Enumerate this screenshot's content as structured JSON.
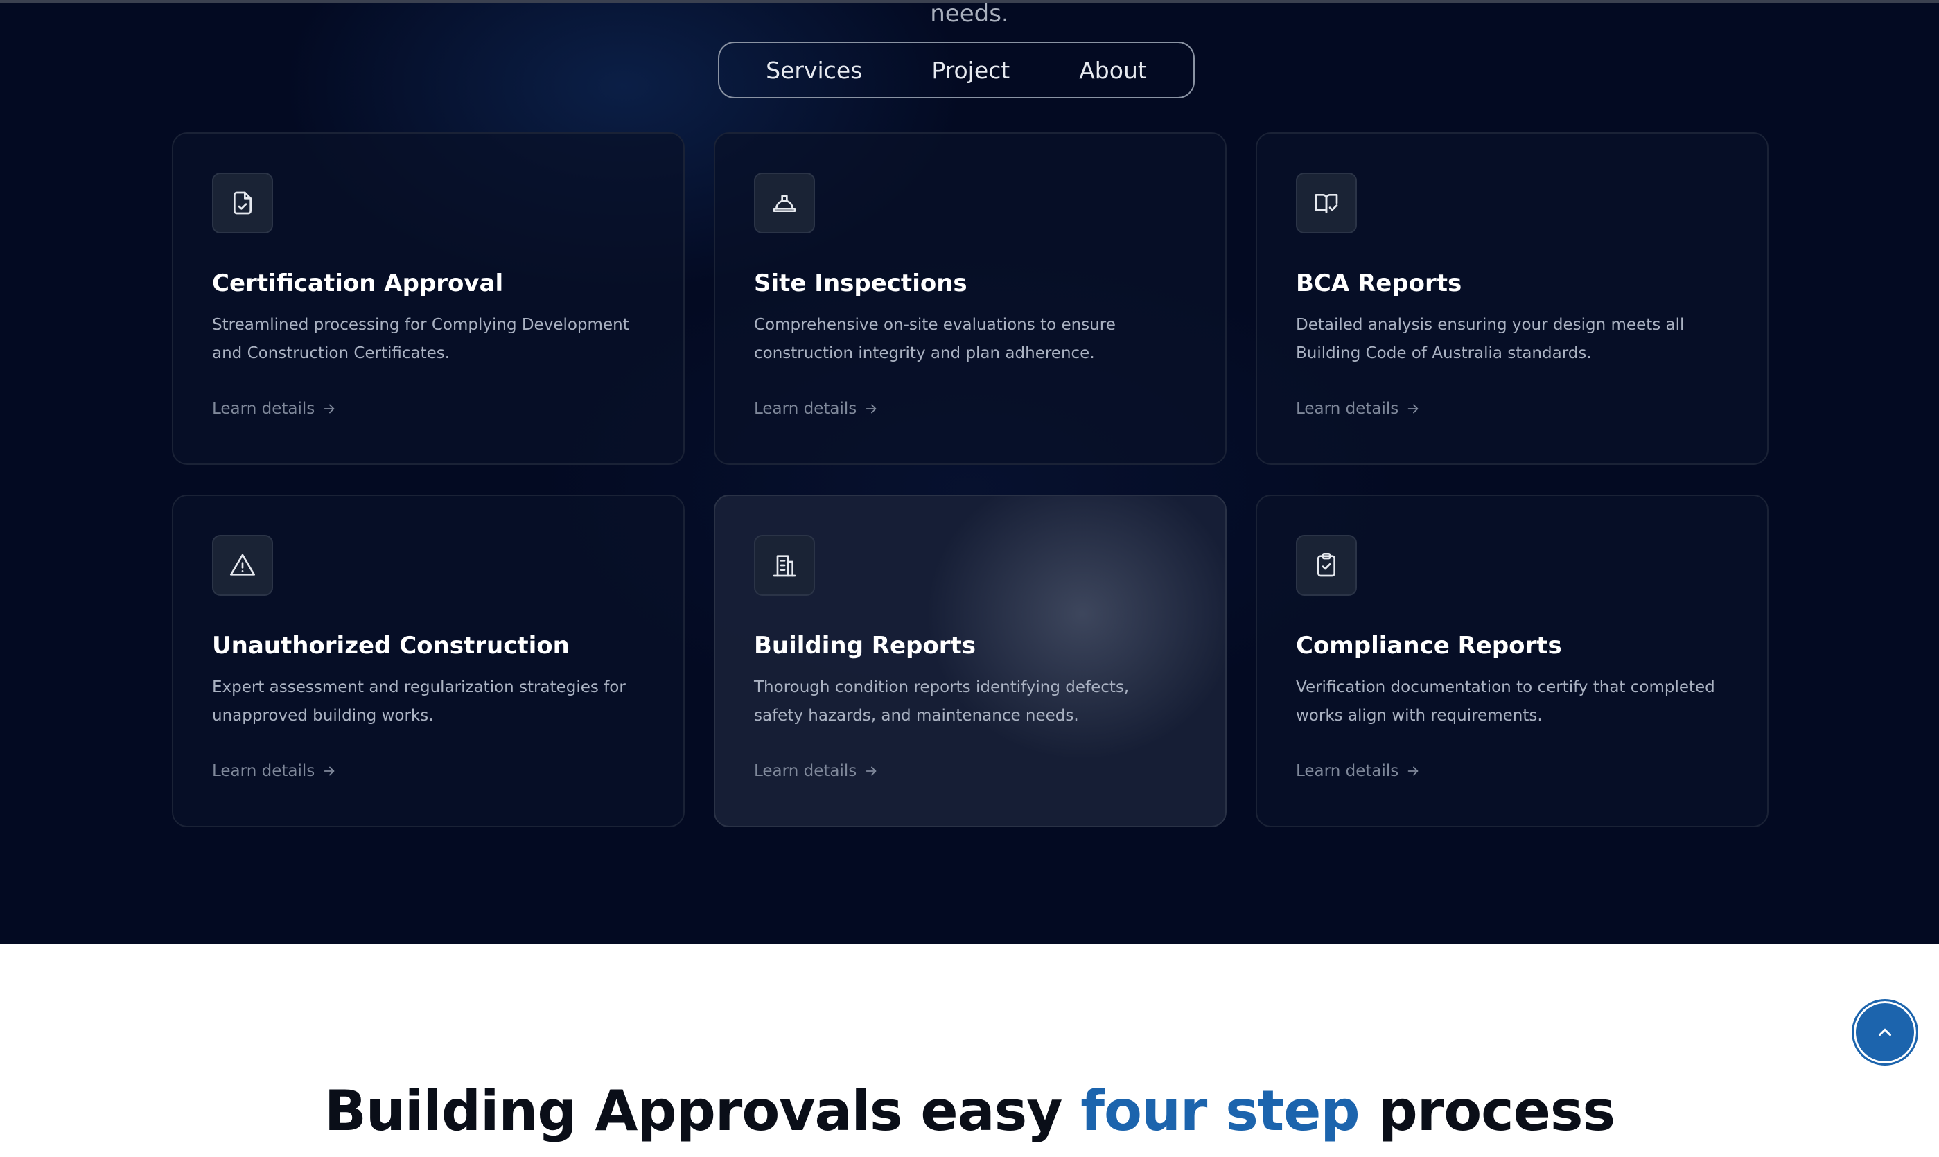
{
  "hero": {
    "subtitle_tail": "needs."
  },
  "nav": {
    "items": [
      {
        "label": "Services"
      },
      {
        "label": "Project"
      },
      {
        "label": "About"
      }
    ]
  },
  "cards": [
    {
      "icon": "file-check-icon",
      "title": "Certification Approval",
      "description": "Streamlined processing for Complying Development and Construction Certificates.",
      "link": "Learn details"
    },
    {
      "icon": "hard-hat-icon",
      "title": "Site Inspections",
      "description": "Comprehensive on-site evaluations to ensure construction integrity and plan adherence.",
      "link": "Learn details"
    },
    {
      "icon": "book-check-icon",
      "title": "BCA Reports",
      "description": "Detailed analysis ensuring your design meets all Building Code of Australia standards.",
      "link": "Learn details"
    },
    {
      "icon": "warning-triangle-icon",
      "title": "Unauthorized Construction",
      "description": "Expert assessment and regularization strategies for unapproved building works.",
      "link": "Learn details"
    },
    {
      "icon": "building-icon",
      "title": "Building Reports",
      "description": "Thorough condition reports identifying defects, safety hazards, and maintenance needs.",
      "link": "Learn details"
    },
    {
      "icon": "clipboard-check-icon",
      "title": "Compliance Reports",
      "description": "Verification documentation to certify that completed works align with requirements.",
      "link": "Learn details"
    }
  ],
  "process": {
    "heading_start": "Building Approvals easy",
    "heading_accent": "four step",
    "heading_end": "process"
  },
  "colors": {
    "accent": "#1c64ad",
    "dark_bg": "#030a22",
    "card_bg": "#081028"
  },
  "back_to_top": {
    "icon": "chevron-up-icon"
  }
}
